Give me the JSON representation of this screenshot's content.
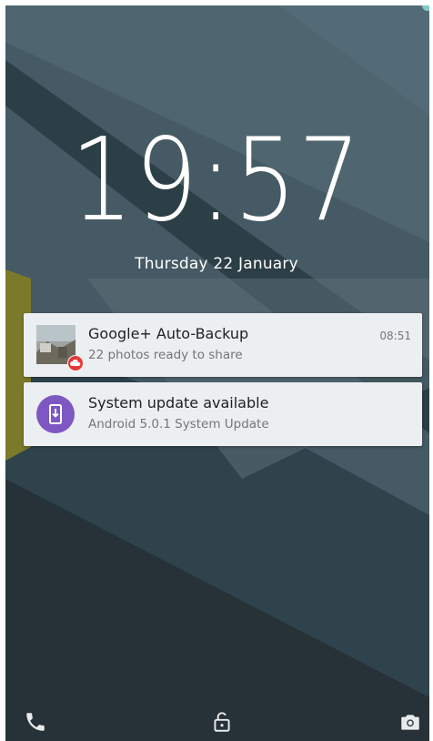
{
  "lockscreen": {
    "time": "19:57",
    "date": "Thursday 22 January"
  },
  "notifications": [
    {
      "icon": "photo-thumbnail-with-cloud-badge-icon",
      "title": "Google+ Auto-Backup",
      "text": "22 photos ready to share",
      "time": "08:51"
    },
    {
      "icon": "system-update-icon",
      "title": "System update available",
      "text": "Android 5.0.1 System Update"
    }
  ],
  "bottom_bar": {
    "left_icon": "phone-icon",
    "center_icon": "unlock-icon",
    "right_icon": "camera-icon"
  },
  "colors": {
    "wallpaper_base": "#37474f",
    "wallpaper_dark": "#263238",
    "wallpaper_accent": "#827717",
    "notification_bg": "#eceff1",
    "update_icon_bg": "#7e57c2",
    "badge_red": "#e53935"
  }
}
